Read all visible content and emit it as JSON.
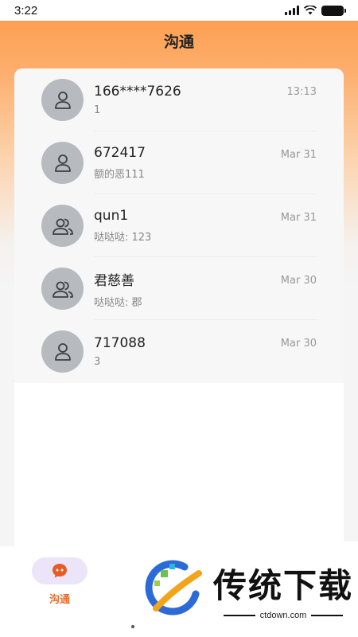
{
  "status": {
    "time": "3:22"
  },
  "header": {
    "title": "沟通"
  },
  "conversations": [
    {
      "name": "166****7626",
      "preview": "1",
      "time": "13:13",
      "avatar": "person-icon"
    },
    {
      "name": "672417",
      "preview": "额的恶111",
      "time": "Mar 31",
      "avatar": "person-icon"
    },
    {
      "name": "qun1",
      "preview": "哒哒哒: 123",
      "time": "Mar 31",
      "avatar": "group-icon"
    },
    {
      "name": "君慈善",
      "preview": "哒哒哒: 郡",
      "time": "Mar 30",
      "avatar": "group-icon"
    },
    {
      "name": "717088",
      "preview": "3",
      "time": "Mar 30",
      "avatar": "person-icon"
    }
  ],
  "tabbar": {
    "chat_label": "沟通"
  },
  "watermark": {
    "title": "传统下载",
    "url": "ctdown.com"
  },
  "colors": {
    "accent": "#fd9a47",
    "tab_active": "#e96b2c",
    "avatar_bg": "#b7bbc0"
  }
}
